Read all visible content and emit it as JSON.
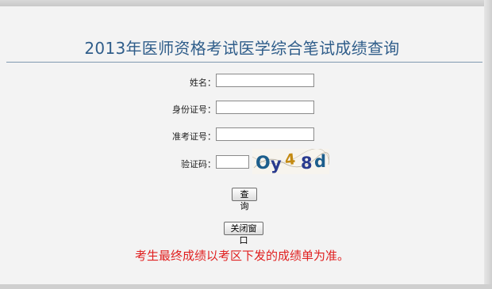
{
  "page": {
    "title": "2013年医师资格考试医学综合笔试成绩查询",
    "notice": "考生最终成绩以考区下发的成绩单为准。"
  },
  "form": {
    "name_label": "姓名：",
    "id_label": "身份证号：",
    "ticket_label": "准考证号：",
    "captcha_label": "验证码：",
    "name_value": "",
    "id_value": "",
    "ticket_value": "",
    "captcha_value": "",
    "captcha_text": "Oy48d",
    "query_label": "查 询",
    "close_label": "关闭窗口"
  },
  "colors": {
    "title": "#2f5d8a",
    "notice": "#e02020"
  }
}
